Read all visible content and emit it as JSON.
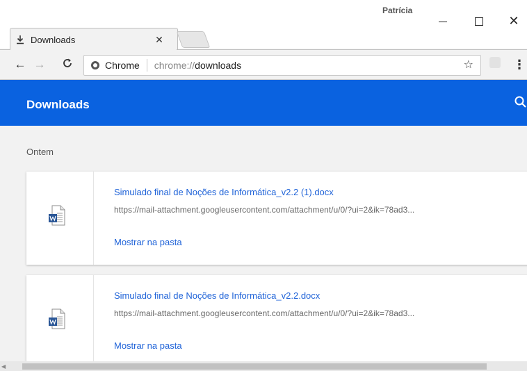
{
  "window": {
    "user_name": "Patrícia",
    "minimize_label": "",
    "maximize_label": "",
    "close_label": "✕"
  },
  "tab": {
    "title": "Downloads",
    "icon": "download-icon",
    "close_label": "✕"
  },
  "toolbar": {
    "back_icon": "←",
    "forward_icon": "→",
    "reload_icon": "C",
    "origin_label": "Chrome",
    "url_scheme": "chrome://",
    "url_host": "downloads",
    "star_icon": "☆",
    "menu_icon": "⋮"
  },
  "header": {
    "title": "Downloads",
    "accent_color": "#0a62e0"
  },
  "content": {
    "date_label": "Ontem",
    "downloads": [
      {
        "file_name": "Simulado final de Noções de Informática_v2.2 (1).docx",
        "url": "https://mail-attachment.googleusercontent.com/attachment/u/0/?ui=2&ik=78ad3...",
        "action_label": "Mostrar na pasta",
        "file_icon": "word-document-icon"
      },
      {
        "file_name": "Simulado final de Noções de Informática_v2.2.docx",
        "url": "https://mail-attachment.googleusercontent.com/attachment/u/0/?ui=2&ik=78ad3...",
        "action_label": "Mostrar na pasta",
        "file_icon": "word-document-icon"
      }
    ]
  }
}
